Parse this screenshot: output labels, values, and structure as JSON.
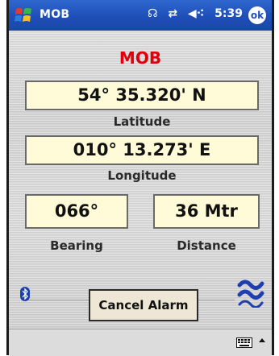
{
  "window": {
    "title": "MOB",
    "time": "5:39",
    "ok_label": "ok"
  },
  "status_icons": [
    "signal-icon",
    "sync-icon",
    "volume-icon"
  ],
  "main": {
    "heading": "MOB",
    "latitude": {
      "value": "54° 35.320' N",
      "label": "Latitude"
    },
    "longitude": {
      "value": "010° 13.273' E",
      "label": "Longitude"
    },
    "bearing": {
      "value": "066°",
      "label": "Bearing"
    },
    "distance": {
      "value": "36 Mtr",
      "label": "Distance"
    },
    "cancel_button": "Cancel Alarm"
  },
  "colors": {
    "titlebar": "#1e4fb8",
    "heading": "#e0000c",
    "field_bg": "#fffbd9"
  },
  "icons": {
    "start": "windows-flag-icon",
    "bluetooth": "bluetooth-icon",
    "waves": "wave-icon",
    "keyboard": "keyboard-icon"
  }
}
